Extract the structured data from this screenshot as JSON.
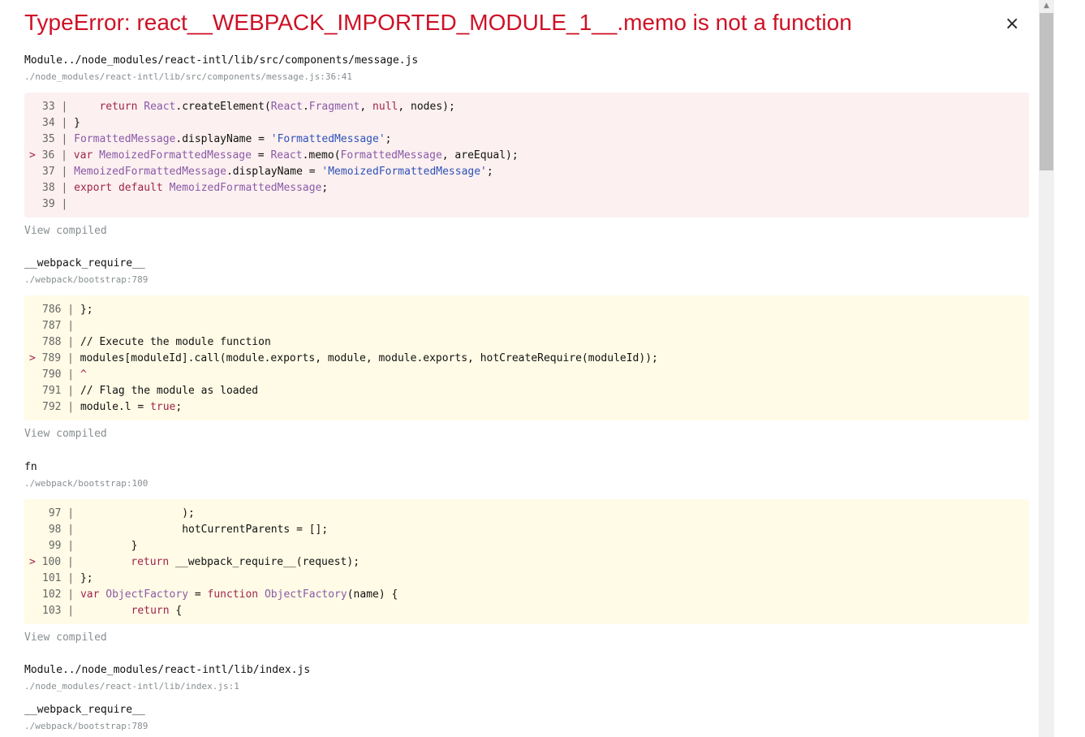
{
  "error": {
    "title": "TypeError: react__WEBPACK_IMPORTED_MODULE_1__.memo is not a function",
    "close_label": "×"
  },
  "frames": [
    {
      "name": "Module../node_modules/react-intl/lib/src/components/message.js",
      "location": "./node_modules/react-intl/lib/src/components/message.js:36:41",
      "lines": [
        "  33 |     return React.createElement(React.Fragment, null, nodes);",
        "  34 | }",
        "  35 | FormattedMessage.displayName = 'FormattedMessage';",
        "> 36 | var MemoizedFormattedMessage = React.memo(FormattedMessage, areEqual);",
        "  37 | MemoizedFormattedMessage.displayName = 'MemoizedFormattedMessage';",
        "  38 | export default MemoizedFormattedMessage;",
        "  39 |"
      ],
      "view_label": "View compiled"
    },
    {
      "name": "__webpack_require__",
      "location": "./webpack/bootstrap:789",
      "lines": [
        "  786 | };",
        "  787 |",
        "  788 | // Execute the module function",
        "> 789 | modules[moduleId].call(module.exports, module, module.exports, hotCreateRequire(moduleId));",
        "  790 | ^",
        "  791 | // Flag the module as loaded",
        "  792 | module.l = true;"
      ],
      "view_label": "View compiled"
    },
    {
      "name": "fn",
      "location": "./webpack/bootstrap:100",
      "lines": [
        "   97 |                 );",
        "   98 |                 hotCurrentParents = [];",
        "   99 |         }",
        "> 100 |         return __webpack_require__(request);",
        "  101 | };",
        "  102 | var ObjectFactory = function ObjectFactory(name) {",
        "  103 |         return {"
      ],
      "view_label": "View compiled"
    },
    {
      "name": "Module../node_modules/react-intl/lib/index.js",
      "location": "./node_modules/react-intl/lib/index.js:1"
    },
    {
      "name": "__webpack_require__",
      "location": "./webpack/bootstrap:789"
    }
  ],
  "colors": {
    "error_red": "#ce1126",
    "app_frame_bg": "#fcf0f0",
    "lib_frame_bg": "#fffbe6",
    "muted": "#878e91"
  }
}
